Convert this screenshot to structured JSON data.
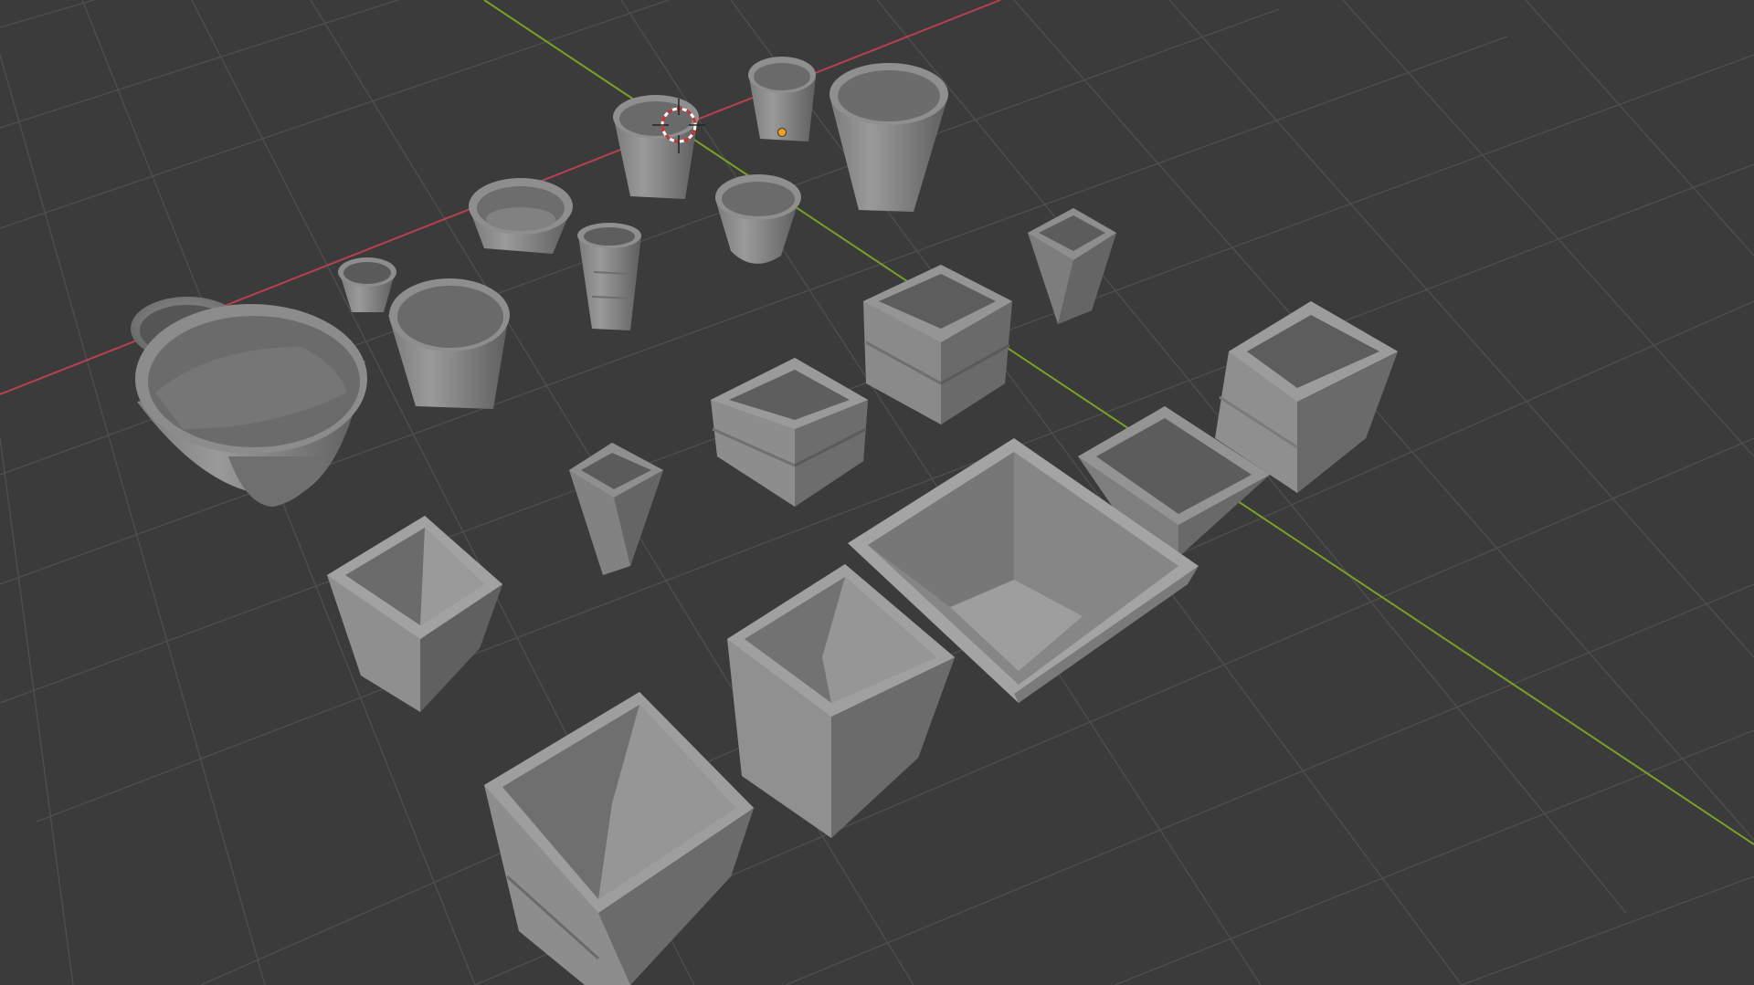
{
  "viewport": {
    "mode": "3D Viewport",
    "shading": "solid",
    "background_color": "#3b3b3b",
    "grid_color": "#4f4f4f",
    "x_axis_color": "#b8414f",
    "y_axis_color": "#7aa026"
  },
  "scene": {
    "object_count": 22,
    "objects": [
      {
        "name": "pot-round-wide-bowl",
        "shape": "round"
      },
      {
        "name": "pot-round-small-back-left",
        "shape": "round"
      },
      {
        "name": "pot-round-tiny",
        "shape": "round"
      },
      {
        "name": "pot-round-medium",
        "shape": "round"
      },
      {
        "name": "pot-round-shallow-dish",
        "shape": "round"
      },
      {
        "name": "pot-octagonal-tall",
        "shape": "octagonal"
      },
      {
        "name": "pot-round-cup-selected",
        "shape": "round"
      },
      {
        "name": "pot-round-cup-back",
        "shape": "round"
      },
      {
        "name": "pot-round-tall-back-right",
        "shape": "round"
      },
      {
        "name": "pot-round-bell",
        "shape": "round"
      },
      {
        "name": "pot-square-tall-small",
        "shape": "square"
      },
      {
        "name": "pot-square-ridged-medium",
        "shape": "square"
      },
      {
        "name": "pot-square-ridged-low",
        "shape": "square"
      },
      {
        "name": "pot-square-slim-center",
        "shape": "square"
      },
      {
        "name": "pot-square-large-right",
        "shape": "square"
      },
      {
        "name": "pot-square-low-right",
        "shape": "square"
      },
      {
        "name": "pot-square-wide-planter",
        "shape": "square"
      },
      {
        "name": "pot-square-open-left",
        "shape": "square"
      },
      {
        "name": "pot-square-tapered-front",
        "shape": "square"
      },
      {
        "name": "pot-square-ridged-front",
        "shape": "square"
      }
    ]
  },
  "cursor": {
    "name": "3d-cursor",
    "colors": [
      "#cc3333",
      "#ffffff"
    ]
  },
  "origin": {
    "name": "object-origin",
    "color": "#f29e1f"
  }
}
